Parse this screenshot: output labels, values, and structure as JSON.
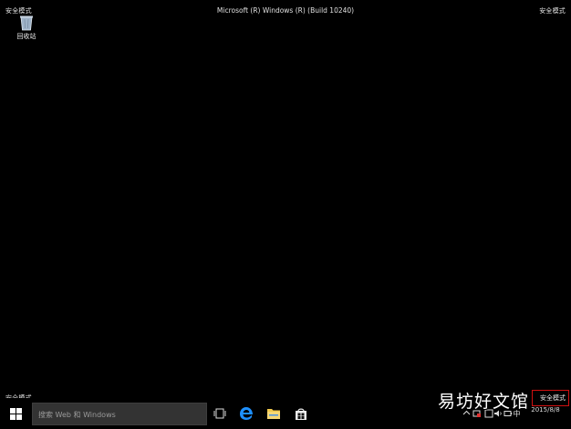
{
  "desktop": {
    "safe_mode_label": "安全模式",
    "build_title": "Microsoft (R) Windows (R) (Build 10240)",
    "recycle_bin_label": "回收站"
  },
  "taskbar": {
    "search_placeholder": "搜索 Web 和 Windows",
    "icons": [
      "windows-start-icon",
      "task-view-icon",
      "edge-icon",
      "file-explorer-icon",
      "store-icon"
    ],
    "tray": {
      "ime_label": "中",
      "date": "2015/8/8",
      "time": "",
      "safe_mode_label": "安全模式"
    }
  },
  "watermark": "易坊好文馆",
  "colors": {
    "background": "#000000",
    "search_box": "#333333",
    "highlight_box": "#d01010",
    "edge_blue": "#1e90ff"
  }
}
